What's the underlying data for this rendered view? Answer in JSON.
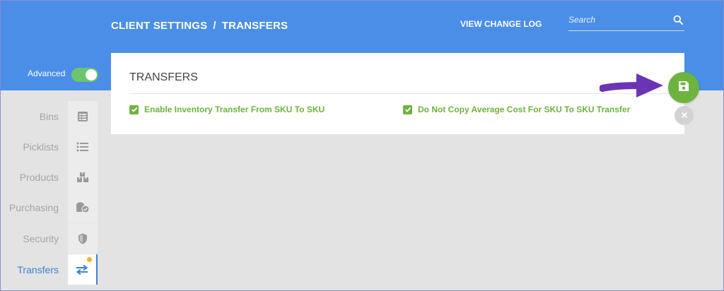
{
  "header": {
    "breadcrumb_root": "CLIENT SETTINGS",
    "breadcrumb_sep": "/",
    "breadcrumb_current": "TRANSFERS",
    "change_log_label": "VIEW CHANGE LOG",
    "search_placeholder": "Search",
    "background_color": "#4a8ee8"
  },
  "advanced": {
    "label": "Advanced",
    "enabled": true,
    "toggle_color": "#6cc46c"
  },
  "sidebar": {
    "items": [
      {
        "label": "Bins",
        "icon": "bins-list-icon",
        "active": false
      },
      {
        "label": "Picklists",
        "icon": "bulleted-list-icon",
        "active": false
      },
      {
        "label": "Products",
        "icon": "boxes-icon",
        "active": false
      },
      {
        "label": "Purchasing",
        "icon": "purchasing-check-icon",
        "active": false
      },
      {
        "label": "Security",
        "icon": "shield-icon",
        "active": false
      },
      {
        "label": "Transfers",
        "icon": "transfer-arrows-icon",
        "active": true,
        "has_notification_dot": true
      }
    ],
    "active_color": "#3b82d6",
    "notification_color": "#f3b32a"
  },
  "panel": {
    "title": "TRANSFERS",
    "options": [
      {
        "label": "Enable Inventory Transfer From SKU To SKU",
        "checked": true
      },
      {
        "label": "Do Not Copy Average Cost For SKU To SKU Transfer",
        "checked": true
      }
    ],
    "check_color": "#6db33f"
  },
  "actions": {
    "save_icon": "floppy-disk-icon",
    "close_icon": "close-icon",
    "save_color": "#6db33f",
    "annotation_arrow_color": "#6a35b5"
  }
}
